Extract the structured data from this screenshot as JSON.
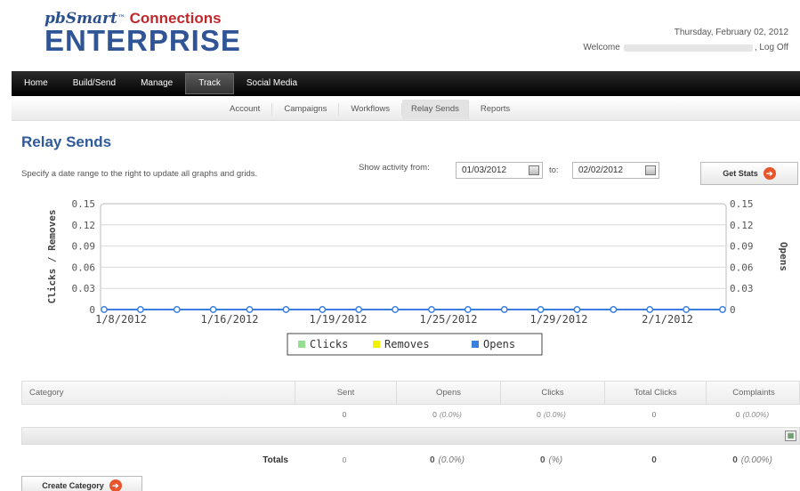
{
  "header": {
    "logo_top_brand": "pbSmart",
    "logo_top_tm": "™",
    "logo_top_product": " Connections",
    "logo_big": "ENTERPRISE",
    "date": "Thursday, February 02, 2012",
    "welcome_label": "Welcome",
    "logoff_label": "Log Off"
  },
  "main_nav": [
    "Home",
    "Build/Send",
    "Manage",
    "Track",
    "Social Media"
  ],
  "main_nav_active": "Track",
  "sub_nav": [
    "Account",
    "Campaigns",
    "Workflows",
    "Relay Sends",
    "Reports"
  ],
  "sub_nav_active": "Relay Sends",
  "page": {
    "title": "Relay Sends",
    "instructions": "Specify a date range to the right to update all graphs and grids.",
    "show_activity_label": "Show activity from:",
    "from_date": "01/03/2012",
    "to_label": "to:",
    "to_date": "02/02/2012",
    "get_stats_label": "Get Stats",
    "create_category_label": "Create Category"
  },
  "chart_data": {
    "type": "line",
    "x_ticks": [
      "1/8/2012",
      "1/16/2012",
      "1/19/2012",
      "1/25/2012",
      "1/29/2012",
      "2/1/2012"
    ],
    "y_left_ticks": [
      "0.15",
      "0.12",
      "0.09",
      "0.06",
      "0.03",
      "0"
    ],
    "y_right_ticks": [
      "0.15",
      "0.12",
      "0.09",
      "0.06",
      "0.03",
      "0"
    ],
    "ylabel_left": "Clicks / Removes",
    "ylabel_right": "Opens",
    "ylim": [
      0,
      0.15
    ],
    "legend_position": "bottom",
    "series": [
      {
        "name": "Clicks",
        "color": "#90e090",
        "values": [
          0,
          0,
          0,
          0,
          0,
          0,
          0,
          0,
          0,
          0,
          0,
          0,
          0,
          0,
          0,
          0,
          0,
          0
        ]
      },
      {
        "name": "Removes",
        "color": "#f0f000",
        "values": [
          0,
          0,
          0,
          0,
          0,
          0,
          0,
          0,
          0,
          0,
          0,
          0,
          0,
          0,
          0,
          0,
          0,
          0
        ]
      },
      {
        "name": "Opens",
        "color": "#3a7fe0",
        "values": [
          0,
          0,
          0,
          0,
          0,
          0,
          0,
          0,
          0,
          0,
          0,
          0,
          0,
          0,
          0,
          0,
          0,
          0
        ]
      }
    ],
    "grid": true
  },
  "table": {
    "headers": [
      "Category",
      "Sent",
      "Opens",
      "Clicks",
      "Total Clicks",
      "Complaints"
    ],
    "row": {
      "sent": "0",
      "opens": "0",
      "opens_pct": "(0.0%)",
      "clicks": "0",
      "clicks_pct": "(0.0%)",
      "total_clicks": "0",
      "complaints": "0",
      "complaints_pct": "(0.00%)"
    },
    "totals": {
      "label": "Totals",
      "sent": "0",
      "opens": "0",
      "opens_pct": "(0.0%)",
      "clicks": "0",
      "clicks_pct": "(%)",
      "total_clicks": "0",
      "complaints": "0",
      "complaints_pct": "(0.00%)"
    }
  }
}
